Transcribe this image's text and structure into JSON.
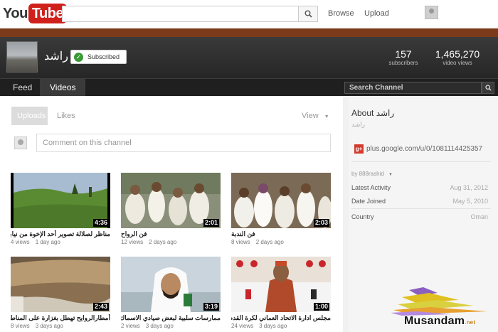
{
  "masthead": {
    "logo_you": "You",
    "logo_tube": "Tube",
    "browse_label": "Browse",
    "upload_label": "Upload"
  },
  "channel": {
    "name": "راشد",
    "subscribed_label": "Subscribed",
    "subscribers_count": "157",
    "subscribers_label": "subscribers",
    "views_count": "1,465,270",
    "views_label": "video views"
  },
  "tabs": [
    {
      "label": "Feed",
      "active": false
    },
    {
      "label": "Videos",
      "active": true
    }
  ],
  "channel_search_placeholder": "Search Channel",
  "main": {
    "uploads_label": "Uploads",
    "likes_label": "Likes",
    "view_label": "View",
    "comment_placeholder": "Comment on this channel"
  },
  "videos": [
    {
      "title": "مناظر لصلالة تصوير أحد الإخوة من نيابة لبم",
      "duration": "4:36",
      "views": "4 views",
      "age": "1 day ago"
    },
    {
      "title": "فن الرواح",
      "duration": "2:01",
      "views": "12 views",
      "age": "2 days ago"
    },
    {
      "title": "فن الندبة",
      "duration": "2:03",
      "views": "8 views",
      "age": "2 days ago"
    },
    {
      "title": "أمطارالروايح تهطل بغزارة على المناطق بالأد",
      "duration": "2:43",
      "views": "8 views",
      "age": "3 days ago"
    },
    {
      "title": "ممارسات سلبية لبعض صيادي الاسماك بكلباء",
      "duration": "3:19",
      "views": "2 views",
      "age": "3 days ago"
    },
    {
      "title": "مجلس ادارة الاتحاد العماني لكرة القدم يقدم",
      "duration": "1:00",
      "views": "24 views",
      "age": "3 days ago"
    }
  ],
  "about": {
    "title": "About راشد",
    "subtitle": "راشد",
    "gplus_icon_text": "g+",
    "gplus_link": "plus.google.com/u/0/1081114425357",
    "byline": "by 888rashid",
    "rows": [
      {
        "label": "Latest Activity",
        "value": "Aug 31, 2012"
      },
      {
        "label": "Date Joined",
        "value": "May 5, 2010"
      },
      {
        "label": "Country",
        "value": "Oman"
      }
    ]
  },
  "watermark": {
    "text": "Musandam",
    "suffix": ".net"
  },
  "colors": {
    "brand_red": "#d0201c",
    "band_brown": "#7b3a1a",
    "header_dark": "#262626",
    "subscribed_green": "#3a9a36"
  }
}
